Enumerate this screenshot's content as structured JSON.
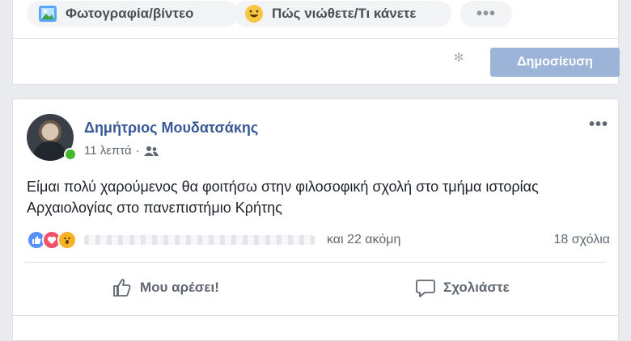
{
  "composer": {
    "photo_video_label": "Φωτογραφία/βίντεο",
    "feeling_label": "Πώς νιώθετε/Τι κάνετε",
    "more_label": "•••",
    "publish_label": "Δημοσίευση"
  },
  "post": {
    "author": "Δημήτριος Μουδατσάκης",
    "time": "11 λεπτά",
    "separator": "·",
    "menu_label": "•••",
    "text": "Είμαι πολύ χαρούμενος θα φοιτήσω στην φιλοσοφική σχολή στο τμήμα ιστορίας Αρχαιολογίας στο πανεπιστήμιο Κρήτης",
    "reactions_others": "και 22 ακόμη",
    "comments_count": "18 σχόλια",
    "like_label": "Μου αρέσει!",
    "comment_label": "Σχολιάστε"
  },
  "colors": {
    "link_blue": "#385898",
    "publish_disabled": "#9cb4d8",
    "online_green": "#42b72a",
    "like_blue": "#5890ff",
    "love_red": "#f25268",
    "wow_yellow": "#f7b125"
  }
}
